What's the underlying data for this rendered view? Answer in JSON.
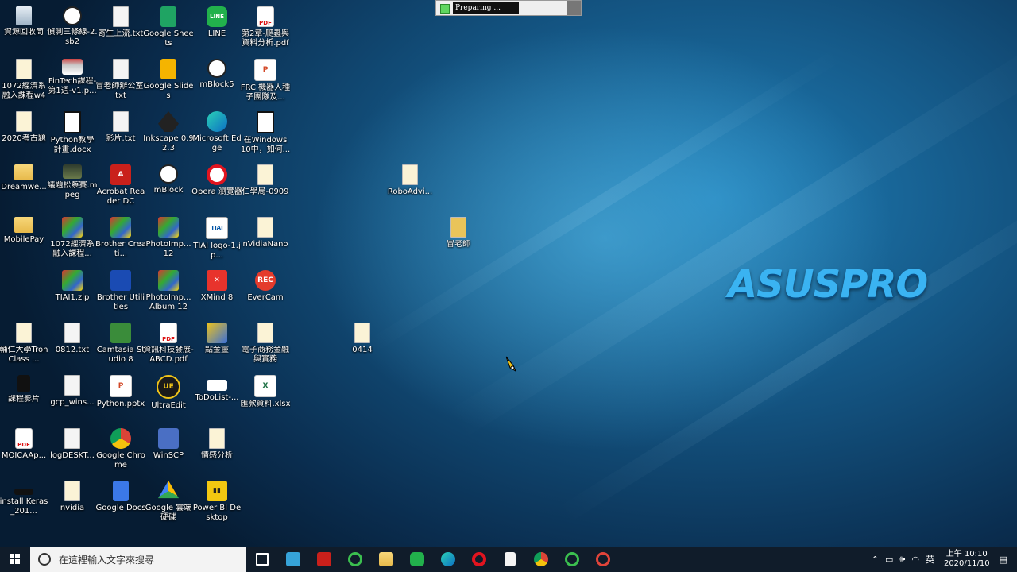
{
  "loading_window": {
    "text": "Preparing ..."
  },
  "brand": {
    "text": "ASUSPRO"
  },
  "desktop_icons": [
    {
      "label": "資源回收筒"
    },
    {
      "label": "偵測三條線-2.sb2"
    },
    {
      "label": "寄生上流.txt"
    },
    {
      "label": "Google Sheets"
    },
    {
      "label": "LINE"
    },
    {
      "label": "第2章-爬蟲與資料分析.pdf"
    },
    {
      "label": "1072經濟系融入課程w4"
    },
    {
      "label": "FinTech課程-第1週-v1.p..."
    },
    {
      "label": "冒老師辦公室.txt"
    },
    {
      "label": "Google Slides"
    },
    {
      "label": "mBlock5"
    },
    {
      "label": "FRC 機器人種子團隊及..."
    },
    {
      "label": "2020考古題"
    },
    {
      "label": "Python教學計畫.docx"
    },
    {
      "label": "影片.txt"
    },
    {
      "label": "Inkscape 0.92.3"
    },
    {
      "label": "Microsoft Edge"
    },
    {
      "label": "在Windows 10中，如何..."
    },
    {
      "label": "Dreamwe..."
    },
    {
      "label": "議題松蔡賽.mpeg"
    },
    {
      "label": "Acrobat Reader DC"
    },
    {
      "label": "mBlock"
    },
    {
      "label": "Opera 瀏覽器"
    },
    {
      "label": "仁學局-0909"
    },
    {
      "label": "RoboAdvi..."
    },
    {
      "label": "MobilePay"
    },
    {
      "label": "1072經濟系融入課程..."
    },
    {
      "label": "Brother Creati..."
    },
    {
      "label": "PhotoImp... 12"
    },
    {
      "label": "TIAI logo-1.jp..."
    },
    {
      "label": "nVidiaNano"
    },
    {
      "label": "冒老師"
    },
    {
      "label": "TIAI1.zip"
    },
    {
      "label": "Brother Utilities"
    },
    {
      "label": "PhotoImp... Album 12"
    },
    {
      "label": "XMind 8"
    },
    {
      "label": "EverCam"
    },
    {
      "label": "輔仁大學TronClass ..."
    },
    {
      "label": "0812.txt"
    },
    {
      "label": "Camtasia Studio 8"
    },
    {
      "label": "資訊科技發展-ABCD.pdf"
    },
    {
      "label": "點金靈"
    },
    {
      "label": "電子商務金融與實務"
    },
    {
      "label": "0414"
    },
    {
      "label": "課程影片"
    },
    {
      "label": "gcp_wins..."
    },
    {
      "label": "Python.pptx"
    },
    {
      "label": "UltraEdit"
    },
    {
      "label": "ToDoList-..."
    },
    {
      "label": "匯款資料.xlsx"
    },
    {
      "label": "MOICAAp..."
    },
    {
      "label": "logDESKT..."
    },
    {
      "label": "Google Chrome"
    },
    {
      "label": "WinSCP"
    },
    {
      "label": "情感分析"
    },
    {
      "label": "install Keras_201..."
    },
    {
      "label": "nvidia"
    },
    {
      "label": "Google Docs"
    },
    {
      "label": "Google 雲端硬碟"
    },
    {
      "label": "Power BI Desktop"
    }
  ],
  "taskbar": {
    "search_placeholder": "在這裡輸入文字來搜尋",
    "ime": "英",
    "time": "上午 10:10",
    "date": "2020/11/10"
  }
}
